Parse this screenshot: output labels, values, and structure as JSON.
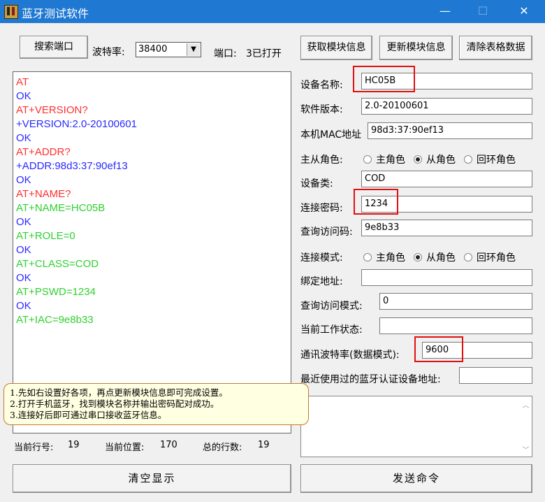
{
  "window": {
    "title": "蓝牙测试软件",
    "minimize": "—",
    "maximize": "☐",
    "close": "✕"
  },
  "toolbar": {
    "search_port": "搜索端口",
    "baud_label": "波特率:",
    "baud_value": "38400",
    "port_label": "端口:",
    "port_status": "3已打开",
    "get_info": "获取模块信息",
    "update_info": "更新模块信息",
    "clear_table": "清除表格数据"
  },
  "log": {
    "lines": [
      {
        "text": "AT",
        "color": "#ff3030"
      },
      {
        "text": "OK",
        "color": "#2a2aff"
      },
      {
        "text": "AT+VERSION?",
        "color": "#ff3030"
      },
      {
        "text": "+VERSION:2.0-20100601",
        "color": "#2a2aff"
      },
      {
        "text": "OK",
        "color": "#2a2aff"
      },
      {
        "text": "AT+ADDR?",
        "color": "#ff3030"
      },
      {
        "text": "+ADDR:98d3:37:90ef13",
        "color": "#2a2aff"
      },
      {
        "text": "OK",
        "color": "#2a2aff"
      },
      {
        "text": "AT+NAME?",
        "color": "#ff3030"
      },
      {
        "text": "AT+NAME=HC05B",
        "color": "#30d030"
      },
      {
        "text": "OK",
        "color": "#2a2aff"
      },
      {
        "text": "AT+ROLE=0",
        "color": "#30d030"
      },
      {
        "text": "OK",
        "color": "#2a2aff"
      },
      {
        "text": "AT+CLASS=COD",
        "color": "#30d030"
      },
      {
        "text": "OK",
        "color": "#2a2aff"
      },
      {
        "text": "AT+PSWD=1234",
        "color": "#30d030"
      },
      {
        "text": "OK",
        "color": "#2a2aff"
      },
      {
        "text": "AT+IAC=9e8b33",
        "color": "#30d030"
      }
    ]
  },
  "form": {
    "device_name_label": "设备名称:",
    "device_name": "HC05B",
    "software_version_label": "软件版本:",
    "software_version": "2.0-20100601",
    "mac_label": "本机MAC地址",
    "mac_value": "98d3:37:90ef13",
    "role_label": "主从角色:",
    "role_options": [
      "主角色",
      "从角色",
      "回环角色"
    ],
    "role_selected": "从角色",
    "class_label": "设备类:",
    "class_value": "COD",
    "password_label": "连接密码:",
    "password_value": "1234",
    "iac_label": "查询访问码:",
    "iac_value": "9e8b33",
    "conn_mode_label": "连接模式:",
    "conn_mode_options": [
      "主角色",
      "从角色",
      "回环角色"
    ],
    "conn_mode_selected": "从角色",
    "bind_addr_label": "绑定地址:",
    "bind_addr_value": "",
    "inq_mode_label": "查询访问模式:",
    "inq_mode_value": "0",
    "work_state_label": "当前工作状态:",
    "work_state_value": "",
    "uart_label": "通讯波特率(数据模式):",
    "uart_value": "9600",
    "recent_label": "最近使用过的蓝牙认证设备地址:",
    "recent_value": ""
  },
  "tip": {
    "lines": [
      "1.先如右设置好各项，再点更新模块信息即可完成设置。",
      "2.打开手机蓝牙，找到模块名称并输出密码配对成功。",
      "3.连接好后即可通过串口接收蓝牙信息。"
    ]
  },
  "status": {
    "line_label": "当前行号:",
    "line_value": "19",
    "pos_label": "当前位置:",
    "pos_value": "170",
    "total_label": "总的行数:",
    "total_value": "19"
  },
  "buttons": {
    "clear_display": "清空显示",
    "send_command": "发送命令"
  },
  "colors": {
    "title_bar": "#1f78d2",
    "highlight": "#e01010",
    "tip_bg": "#ffffe1"
  }
}
